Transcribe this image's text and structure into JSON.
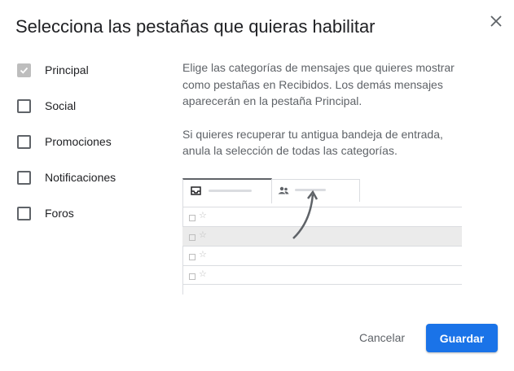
{
  "dialog": {
    "title": "Selecciona las pestañas que quieras habilitar",
    "close_icon": "close-icon"
  },
  "options": [
    {
      "label": "Principal",
      "checked": true,
      "disabled": true
    },
    {
      "label": "Social",
      "checked": false
    },
    {
      "label": "Promociones",
      "checked": false
    },
    {
      "label": "Notificaciones",
      "checked": false
    },
    {
      "label": "Foros",
      "checked": false
    }
  ],
  "description": {
    "p1": "Elige las categorías de mensajes que quieres mostrar como pestañas en Recibidos. Los demás mensajes aparecerán en la pestaña Principal.",
    "p2": "Si quieres recuperar tu antigua bandeja de entrada, anula la selección de todas las categorías."
  },
  "illustration": {
    "tab_icons": [
      "inbox-icon",
      "people-icon"
    ],
    "row_icons": [
      "checkbox-icon",
      "star-icon"
    ],
    "star_glyph": "☆"
  },
  "actions": {
    "cancel_label": "Cancelar",
    "save_label": "Guardar"
  },
  "colors": {
    "primary": "#1a73e8",
    "text": "#202124",
    "muted": "#5f6368",
    "border": "#dadce0"
  }
}
